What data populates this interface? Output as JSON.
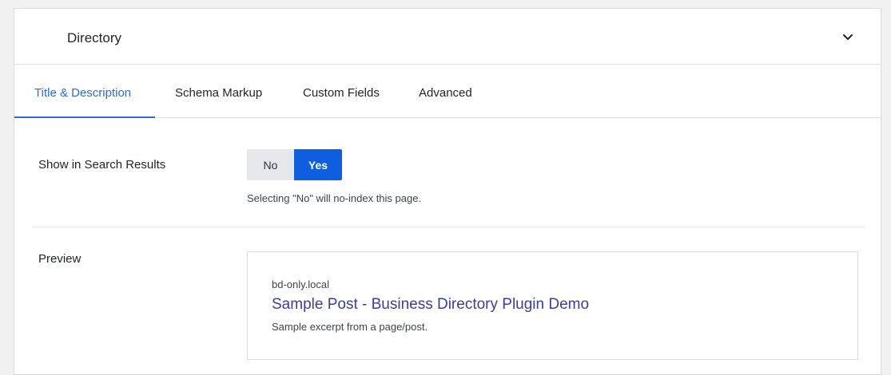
{
  "panel": {
    "title": "Directory",
    "toggle_icon": "chevron-down-icon"
  },
  "tabs": [
    {
      "label": "Title & Description",
      "active": true
    },
    {
      "label": "Schema Markup",
      "active": false
    },
    {
      "label": "Custom Fields",
      "active": false
    },
    {
      "label": "Advanced",
      "active": false
    }
  ],
  "search_results": {
    "label": "Show in Search Results",
    "options": [
      "No",
      "Yes"
    ],
    "selected": "Yes",
    "help": "Selecting \"No\" will no-index this page."
  },
  "preview": {
    "label": "Preview",
    "url": "bd-only.local",
    "title": "Sample Post - Business Directory Plugin Demo",
    "description": "Sample excerpt from a page/post."
  },
  "colors": {
    "accent": "#2b6cd8",
    "toggle_selected": "#0e5fe0",
    "preview_title": "#3b3d9e"
  }
}
